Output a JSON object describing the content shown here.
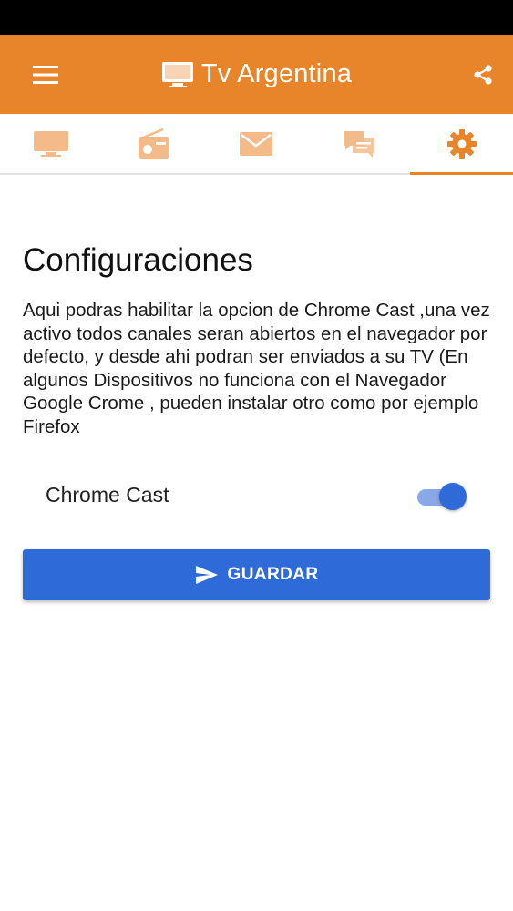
{
  "app_bar": {
    "title": "Tv Argentina",
    "color": "#e8842a",
    "menu_icon": "hamburger-menu-icon",
    "logo_icon": "tv-icon",
    "share_icon": "share-icon"
  },
  "tabs": [
    {
      "icon": "tv-icon",
      "active": false
    },
    {
      "icon": "radio-icon",
      "active": false
    },
    {
      "icon": "mail-icon",
      "active": false
    },
    {
      "icon": "chat-icon",
      "active": false
    },
    {
      "icon": "gear-icon",
      "active": true
    }
  ],
  "main": {
    "title": "Configuraciones",
    "description": "Aqui podras habilitar la opcion de Chrome Cast ,una vez activo todos canales seran abiertos en el navegador por defecto, y desde ahi podran ser enviados a su TV (En algunos Dispositivos no funciona con el Navegador Google Crome , pueden instalar otro como por ejemplo Firefox",
    "setting": {
      "label": "Chrome Cast",
      "enabled": true
    },
    "save_button": {
      "label": "GUARDAR",
      "icon": "send-icon",
      "color": "#2f6ad9"
    }
  }
}
